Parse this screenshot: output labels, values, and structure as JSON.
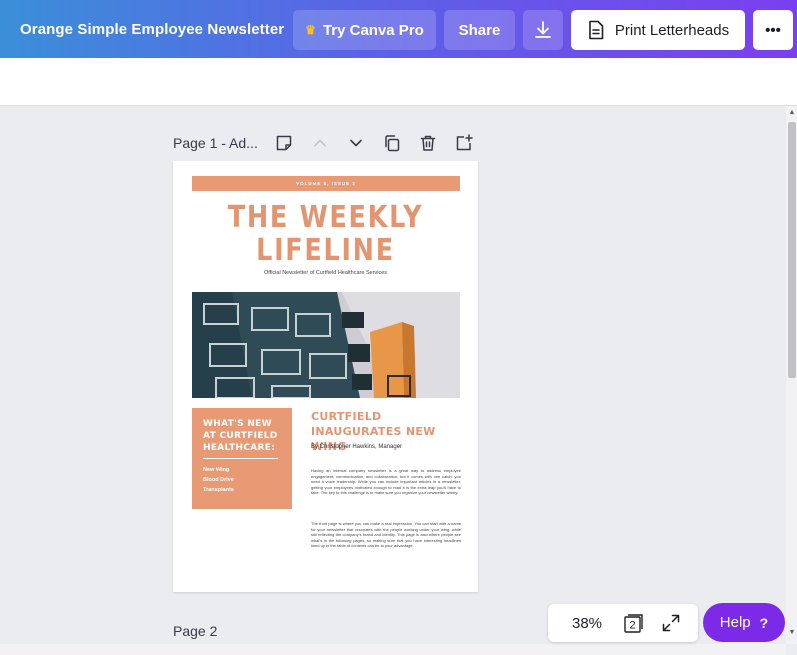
{
  "header": {
    "title": "Orange Simple Employee Newsletter",
    "try_pro_label": "Try Canva Pro",
    "share_label": "Share",
    "print_label": "Print Letterheads",
    "more_label": "•••"
  },
  "page_toolbar": {
    "page1_label": "Page 1 - Ad..."
  },
  "newsletter": {
    "volume": "VOLUME 5, ISSUE 2",
    "headline_line1": "THE WEEKLY",
    "headline_line2": "LIFELINE",
    "subhead": "Official Newsletter of Curtfield Healthcare Services",
    "sidebar_title": "WHAT'S NEW AT CURTFIELD HEALTHCARE:",
    "sidebar_items": [
      "New Wing",
      "Blood Drive",
      "Transplants"
    ],
    "article_title": "CURTFIELD INAUGURATES NEW WING",
    "byline": "By Christopher Hawkins, Manager",
    "paragraph1": "Having an internal company newsletter is a great way to address employee engagement, communication, and collaboration, but it comes with one catch: you need a voice leadership. While you can include important articles in a newsletter, getting your employees motivated enough to read it is the extra leap you'll have to take. The key to this challenge is to make sure you organize your newsletter wisely.",
    "paragraph2": "The front page is where you can make a real impression. You can start with a name for your newsletter that resonates with the people working under your wing, while still reflecting the company's brand and identity. This page is also where people see what's in the following pages, so making sure that you have interesting headlines lined up in the table of contents can be to your advantage."
  },
  "page2_label": "Page 2",
  "zoom": {
    "percent": "38%",
    "page_count": "2"
  },
  "help_label": "Help",
  "help_q": "?",
  "colors": {
    "accent_orange": "#e89a74",
    "help_purple": "#7d2ae8"
  }
}
